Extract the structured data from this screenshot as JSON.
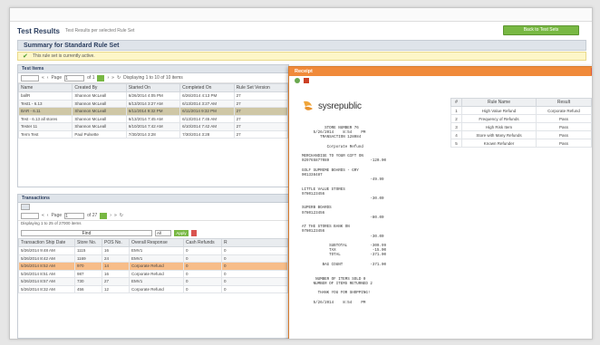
{
  "header": {
    "title": "Test Results",
    "subtitle": "Test Results per selected Rule Set",
    "back_label": "Back to Test Sets"
  },
  "summary": {
    "title": "Summary for Standard Rule Set"
  },
  "notice": {
    "text": "This rule set is currently active."
  },
  "test_items": {
    "title": "Test Items",
    "pager": {
      "page_label": "Page",
      "page_value": "1",
      "of_label": "of 1",
      "display_text": "Displaying 1 to 10 of 10 items"
    },
    "columns": [
      "Name",
      "Created By",
      "Started On",
      "Completed On",
      "Rule Set Version"
    ],
    "rows": [
      [
        "ballR",
        "Shannon McLeall",
        "6/26/2014 4:05 PM",
        "6/26/2014 4:13 PM",
        "27"
      ],
      [
        "Test1 - 6.13",
        "Shannon McLeall",
        "6/13/2014 3:27 AM",
        "6/13/2014 3:27 AM",
        "27"
      ],
      [
        "BAR - 6.11",
        "Shannon McLeall",
        "6/11/2014 9:32 PM",
        "6/11/2014 9:32 PM",
        "27"
      ],
      [
        "Test - 6.13 all stores",
        "Shannon McLeall",
        "6/13/2014 7:45 AM",
        "6/13/2014 7:45 AM",
        "27"
      ],
      [
        "Tester 11",
        "Shannon McLeall",
        "6/10/2014 7:42 AM",
        "6/10/2014 7:42 AM",
        "27"
      ],
      [
        "Term Test",
        "Paul Pulsette",
        "7/30/2014 3:28",
        "7/30/2014 3:28",
        "27"
      ]
    ]
  },
  "transactions": {
    "title": "Transactions",
    "pager": {
      "page_label": "Page",
      "page_value": "1",
      "of_label": "of 27",
      "display_text": "Displaying 1 to 25 of 27000 items"
    },
    "filter": {
      "value": "Find",
      "select": "All",
      "apply_label": "Apply"
    },
    "columns": [
      "Transaction Ship Date",
      "Store No.",
      "POS No.",
      "Overall Response",
      "Cash Refunds",
      "R"
    ],
    "rows": [
      [
        "5/26/2014 9:48 AM",
        "1115",
        "16",
        "EMV1",
        "0",
        "0"
      ],
      [
        "5/26/2014 8:42 AM",
        "1169",
        "24",
        "EMV1",
        "0",
        "0"
      ],
      [
        "5/26/2014 8:52 AM",
        "970",
        "14",
        "Corporate Refund",
        "0",
        "0"
      ],
      [
        "5/26/2014 8:51 AM",
        "987",
        "16",
        "Corporate Refund",
        "0",
        "0"
      ],
      [
        "5/26/2014 8:57 AM",
        "730",
        "27",
        "EMV1",
        "0",
        "0"
      ],
      [
        "5/26/2014 8:32 AM",
        "456",
        "12",
        "Corporate Refund",
        "0",
        "0"
      ]
    ]
  },
  "dialog": {
    "title": "Receipt",
    "logo": "sysrepublic",
    "receipt_lines": "          STORE NUMBER 76\n     5/26/2014    8:54    PM\n        TRANSACTION 128084\n\n           Corporate Refund\n\nMERCHANDISE TO YOUR GIFT ON\n029765877089                  -120.00\n\nGOLF SUPREME BOARDS - GRY\n001338487\n                              -49.99\n\nLITTLE VALUE STORES\n9780123456\n                              -30.00\n\nSUPERB BOARDS\n9780123456\n                              -80.00\n\nAT THE STORES BANK ON\n9780123456\n                              -30.00\n\n            SUBTOTAL          -309.99\n            TAX                -15.00\n            TOTAL             -371.00\n\n         BAG COUNT            -371.00\n\n\n      NUMBER OF ITEMS SOLD 0\n     NUMBER OF ITEMS RETURNED 2\n\n       THANK YOU FOR SHOPPING!\n\n     5/26/2014    8:54    PM",
    "rules_columns": [
      "#",
      "Rule Name",
      "Result"
    ],
    "rules_rows": [
      [
        "1",
        "High Value Refund",
        "Corporate Refund"
      ],
      [
        "2",
        "Frequency of Refunds",
        "Pass"
      ],
      [
        "3",
        "High Risk Item",
        "Pass"
      ],
      [
        "4",
        "Store with Many Refunds",
        "Pass"
      ],
      [
        "5",
        "Known Refunder",
        "Pass"
      ]
    ]
  },
  "colors": {
    "accent_orange": "#f08a3a",
    "green": "#78b843",
    "highlight_tan": "#cfc7a6",
    "highlight_orange": "#f7bd89"
  }
}
